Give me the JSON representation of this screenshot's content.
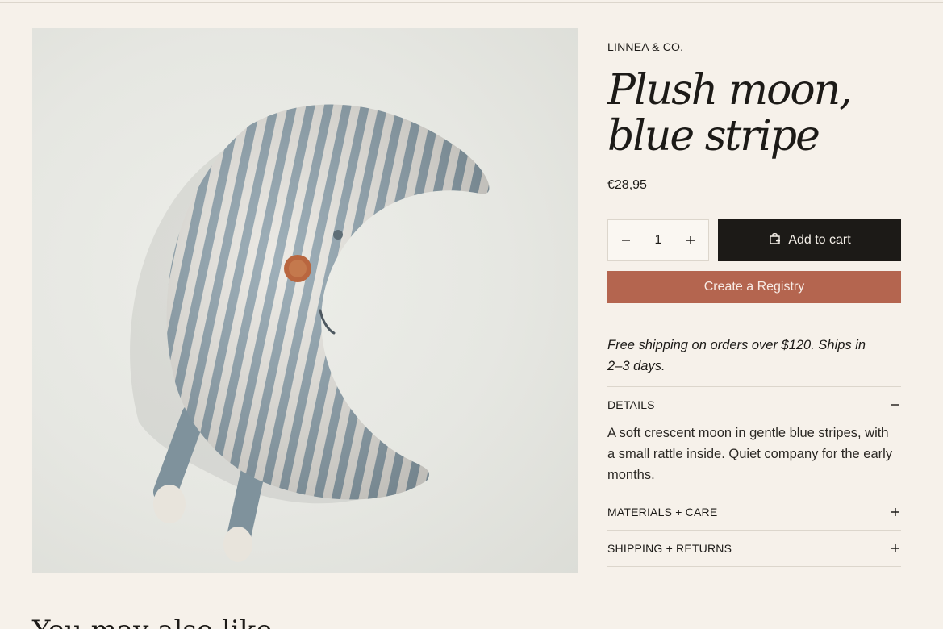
{
  "product": {
    "brand": "LINNEA & CO.",
    "title_line1": "Plush moon,",
    "title_line2": "blue stripe",
    "price": "€28,95",
    "image_alt": "Striped plush moon toy"
  },
  "quantity": {
    "value": "1"
  },
  "buttons": {
    "add_to_cart": "Add to cart",
    "create_registry": "Create a Registry"
  },
  "shipping_note": "Free shipping on orders over $120. Ships in 2–3 days.",
  "accordion": [
    {
      "title": "DETAILS",
      "expanded": true,
      "body": "A soft crescent moon in gentle blue stripes, with a small rattle inside. Quiet company for the early months."
    },
    {
      "title": "MATERIALS + CARE",
      "expanded": false
    },
    {
      "title": "SHIPPING + RETURNS",
      "expanded": false
    }
  ],
  "related": {
    "heading": "You may also like"
  },
  "colors": {
    "background": "#f6f1ea",
    "primary_button": "#1c1a17",
    "registry_button": "#b4654f",
    "stripe_blue": "#8ea2ad"
  },
  "icons": [
    "minus-icon",
    "plus-icon",
    "bag-icon",
    "collapse-minus-icon",
    "expand-plus-icon"
  ]
}
